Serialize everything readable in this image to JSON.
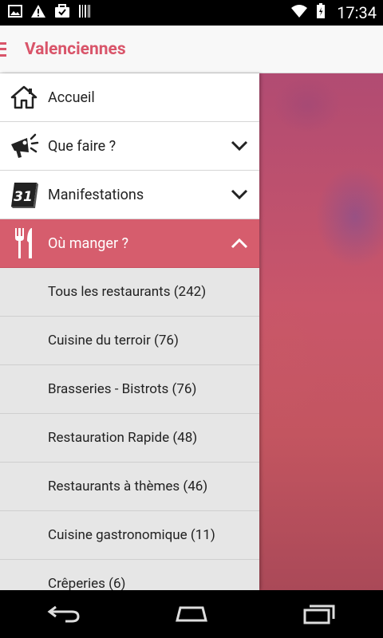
{
  "status_bar": {
    "time": "17:34",
    "left_icons": [
      "image-icon",
      "warning-icon",
      "briefcase-icon",
      "barcode-icon"
    ],
    "right_icons": [
      "wifi-icon",
      "battery-icon"
    ]
  },
  "app_bar": {
    "title": "Valenciennes",
    "menu_icon": "hamburger-icon",
    "accent_color": "#d9556a"
  },
  "drawer": {
    "items": [
      {
        "label": "Accueil",
        "icon": "home-icon",
        "expandable": false,
        "expanded": false
      },
      {
        "label": "Que faire ?",
        "icon": "megaphone-icon",
        "expandable": true,
        "expanded": false
      },
      {
        "label": "Manifestations",
        "icon": "calendar-31-icon",
        "expandable": true,
        "expanded": false
      },
      {
        "label": "Où manger ?",
        "icon": "fork-knife-icon",
        "expandable": true,
        "expanded": true,
        "active": true
      }
    ],
    "calendar_number": "31",
    "subitems": [
      {
        "label": "Tous les restaurants (242)"
      },
      {
        "label": "Cuisine du terroir (76)"
      },
      {
        "label": "Brasseries - Bistrots (76)"
      },
      {
        "label": "Restauration Rapide (48)"
      },
      {
        "label": "Restaurants à thèmes (46)"
      },
      {
        "label": "Cuisine gastronomique (11)"
      },
      {
        "label": "Crêperies (6)"
      }
    ],
    "active_color": "#d65d6d"
  },
  "nav_bar": {
    "buttons": [
      "back-icon",
      "home-icon",
      "recents-icon"
    ]
  }
}
